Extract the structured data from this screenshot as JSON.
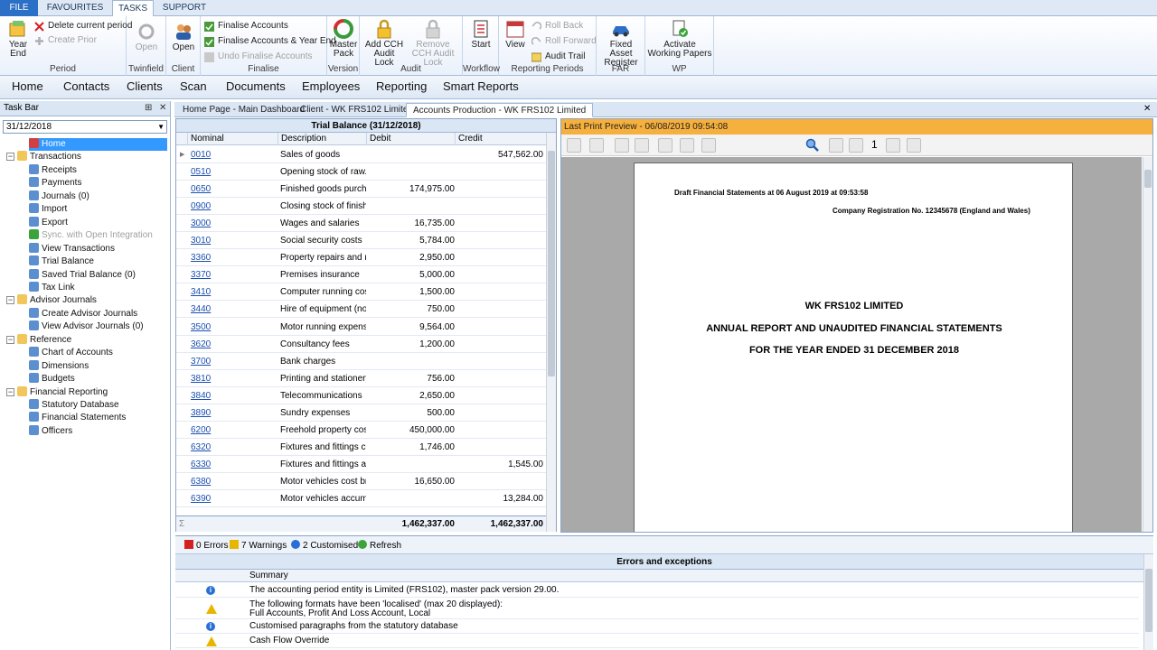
{
  "ribbon": {
    "tabs": [
      "FILE",
      "FAVOURITES",
      "TASKS",
      "SUPPORT"
    ],
    "period": {
      "label": "Period",
      "year_end": "Year End",
      "delete_current_period": "Delete current period",
      "create_prior": "Create Prior"
    },
    "twinfield": {
      "label": "Twinfield",
      "open": "Open"
    },
    "client": {
      "label": "Client",
      "open": "Open"
    },
    "finalise": {
      "label": "Finalise",
      "finalise_accounts": "Finalise Accounts",
      "finalise_accounts_year_end": "Finalise Accounts & Year End",
      "undo_finalise_accounts": "Undo Finalise Accounts"
    },
    "version": {
      "label": "Version",
      "master_pack": "Master Pack"
    },
    "audit": {
      "label": "Audit",
      "add_lock": "Add CCH Audit Lock",
      "remove_lock": "Remove CCH Audit Lock"
    },
    "workflow": {
      "label": "Workflow",
      "start": "Start"
    },
    "reporting_periods": {
      "label": "Reporting Periods",
      "view": "View",
      "roll_back": "Roll Back",
      "roll_forward": "Roll Forward",
      "audit_trail": "Audit Trail"
    },
    "far": {
      "label": "FAR",
      "fixed_asset_register": "Fixed Asset Register"
    },
    "wp": {
      "label": "WP",
      "activate_working_papers": "Activate Working Papers"
    }
  },
  "nav": [
    "Home",
    "Contacts",
    "Clients",
    "Scan",
    "Documents",
    "Employees",
    "Reporting",
    "Smart Reports"
  ],
  "taskbar": {
    "title": "Task Bar",
    "date": "31/12/2018",
    "tree": [
      {
        "label": "Home",
        "level": 1,
        "selected": true,
        "icon": "home-icon"
      },
      {
        "label": "Transactions",
        "level": 0,
        "icon": "folder-icon"
      },
      {
        "label": "Receipts",
        "level": 1,
        "icon": "receipts-icon"
      },
      {
        "label": "Payments",
        "level": 1,
        "icon": "payments-icon"
      },
      {
        "label": "Journals (0)",
        "level": 1,
        "icon": "journal-icon"
      },
      {
        "label": "Import",
        "level": 1,
        "icon": "import-icon"
      },
      {
        "label": "Export",
        "level": 1,
        "icon": "export-icon"
      },
      {
        "label": "Sync. with Open Integration",
        "level": 1,
        "disabled": true,
        "icon": "sync-icon"
      },
      {
        "label": "View Transactions",
        "level": 1,
        "icon": "view-transactions-icon"
      },
      {
        "label": "Trial Balance",
        "level": 1,
        "icon": "trial-balance-icon"
      },
      {
        "label": "Saved Trial Balance (0)",
        "level": 1,
        "icon": "saved-trial-balance-icon"
      },
      {
        "label": "Tax Link",
        "level": 1,
        "icon": "tax-link-icon"
      },
      {
        "label": "Advisor Journals",
        "level": 0,
        "icon": "folder-icon"
      },
      {
        "label": "Create Advisor Journals",
        "level": 1,
        "icon": "journal-icon"
      },
      {
        "label": "View Advisor Journals (0)",
        "level": 1,
        "icon": "journal-icon"
      },
      {
        "label": "Reference",
        "level": 0,
        "icon": "folder-icon"
      },
      {
        "label": "Chart of Accounts",
        "level": 1,
        "icon": "chart-accounts-icon"
      },
      {
        "label": "Dimensions",
        "level": 1,
        "icon": "dimensions-icon"
      },
      {
        "label": "Budgets",
        "level": 1,
        "icon": "budgets-icon"
      },
      {
        "label": "Financial Reporting",
        "level": 0,
        "icon": "folder-icon"
      },
      {
        "label": "Statutory Database",
        "level": 1,
        "icon": "database-icon"
      },
      {
        "label": "Financial Statements",
        "level": 1,
        "icon": "statements-icon"
      },
      {
        "label": "Officers",
        "level": 1,
        "icon": "officers-icon"
      }
    ]
  },
  "doc_tabs": [
    "Home Page - Main Dashboard",
    "Client - WK FRS102 Limited",
    "Accounts Production - WK FRS102 Limited"
  ],
  "trial_balance": {
    "title": "Trial Balance (31/12/2018)",
    "columns": [
      "Nominal",
      "Description",
      "Debit",
      "Credit"
    ],
    "rows": [
      {
        "nominal": "0010",
        "description": "Sales of goods",
        "debit": "",
        "credit": "547,562.00"
      },
      {
        "nominal": "0510",
        "description": "Opening stock of raw...",
        "debit": "",
        "credit": ""
      },
      {
        "nominal": "0650",
        "description": "Finished goods purcha...",
        "debit": "174,975.00",
        "credit": ""
      },
      {
        "nominal": "0900",
        "description": "Closing stock of finishe...",
        "debit": "",
        "credit": ""
      },
      {
        "nominal": "3000",
        "description": "Wages and salaries",
        "debit": "16,735.00",
        "credit": ""
      },
      {
        "nominal": "3010",
        "description": "Social security costs",
        "debit": "5,784.00",
        "credit": ""
      },
      {
        "nominal": "3360",
        "description": "Property repairs and m...",
        "debit": "2,950.00",
        "credit": ""
      },
      {
        "nominal": "3370",
        "description": "Premises insurance",
        "debit": "5,000.00",
        "credit": ""
      },
      {
        "nominal": "3410",
        "description": "Computer running costs",
        "debit": "1,500.00",
        "credit": ""
      },
      {
        "nominal": "3440",
        "description": "Hire of equipment (not...",
        "debit": "750.00",
        "credit": ""
      },
      {
        "nominal": "3500",
        "description": "Motor running expenses",
        "debit": "9,564.00",
        "credit": ""
      },
      {
        "nominal": "3620",
        "description": "Consultancy fees",
        "debit": "1,200.00",
        "credit": ""
      },
      {
        "nominal": "3700",
        "description": "Bank charges",
        "debit": "",
        "credit": ""
      },
      {
        "nominal": "3810",
        "description": "Printing and stationery",
        "debit": "756.00",
        "credit": ""
      },
      {
        "nominal": "3840",
        "description": "Telecommunications",
        "debit": "2,650.00",
        "credit": ""
      },
      {
        "nominal": "3890",
        "description": "Sundry expenses",
        "debit": "500.00",
        "credit": ""
      },
      {
        "nominal": "6200",
        "description": "Freehold property cost...",
        "debit": "450,000.00",
        "credit": ""
      },
      {
        "nominal": "6320",
        "description": "Fixtures and fittings co...",
        "debit": "1,746.00",
        "credit": ""
      },
      {
        "nominal": "6330",
        "description": "Fixtures and fittings ac...",
        "debit": "",
        "credit": "1,545.00"
      },
      {
        "nominal": "6380",
        "description": "Motor vehicles cost bro...",
        "debit": "16,650.00",
        "credit": ""
      },
      {
        "nominal": "6390",
        "description": "Motor vehicles accumu...",
        "debit": "",
        "credit": "13,284.00"
      }
    ],
    "total_debit": "1,462,337.00",
    "total_credit": "1,462,337.00",
    "sum_symbol": "Σ"
  },
  "print_preview": {
    "header": "Last Print Preview - 06/08/2019 09:54:08",
    "page_number": "1",
    "draft_line": "Draft Financial Statements at 06 August 2019 at 09:53:58",
    "reg_line": "Company Registration No. 12345678 (England and Wales)",
    "company": "WK FRS102 LIMITED",
    "report_title": "ANNUAL REPORT AND UNAUDITED FINANCIAL STATEMENTS",
    "year_line": "FOR THE YEAR ENDED 31 DECEMBER 2018"
  },
  "errors": {
    "errors_count": "0 Errors",
    "warnings_count": "7 Warnings",
    "customised_count": "2 Customised",
    "refresh": "Refresh",
    "title": "Errors and exceptions",
    "summary_header": "Summary",
    "rows": [
      {
        "type": "info",
        "line1": "The accounting period entity is Limited (FRS102), master pack version 29.00.",
        "line2": ""
      },
      {
        "type": "warning",
        "line1": "The following formats have been 'localised' (max 20 displayed):",
        "line2": "Full Accounts, Profit And Loss Account, Local"
      },
      {
        "type": "info",
        "line1": "Customised paragraphs from the statutory database",
        "line2": ""
      },
      {
        "type": "warning",
        "line1": "Cash Flow Override",
        "line2": ""
      }
    ]
  },
  "colors": {
    "file_tab": "#2b6fc7",
    "selection": "#3399ff",
    "preview_header": "#f6b03e",
    "link": "#1a4fb0"
  }
}
